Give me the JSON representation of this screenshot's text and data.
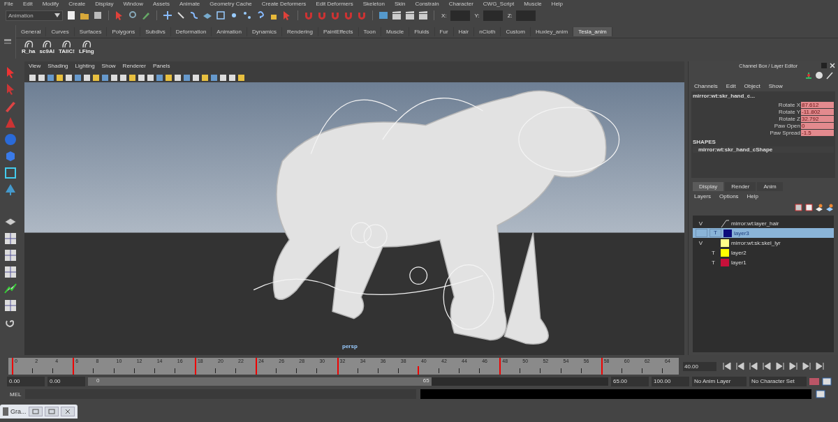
{
  "menu_bar": [
    "File",
    "Edit",
    "Modify",
    "Create",
    "Display",
    "Window",
    "Assets",
    "Animate",
    "Geometry Cache",
    "Create Deformers",
    "Edit Deformers",
    "Skeleton",
    "Skin",
    "Constrain",
    "Character",
    "CWG_Script",
    "Muscle",
    "Help"
  ],
  "status_line": {
    "mode": "Animation",
    "coords": [
      "X:",
      "Y:",
      "Z:"
    ]
  },
  "shelf": {
    "tabs": [
      {
        "label": "General",
        "selected": false
      },
      {
        "label": "Curves",
        "selected": false
      },
      {
        "label": "Surfaces",
        "selected": false
      },
      {
        "label": "Polygons",
        "selected": false
      },
      {
        "label": "Subdivs",
        "selected": false
      },
      {
        "label": "Deformation",
        "selected": false
      },
      {
        "label": "Animation",
        "selected": false
      },
      {
        "label": "Dynamics",
        "selected": false
      },
      {
        "label": "Rendering",
        "selected": false
      },
      {
        "label": "PaintEffects",
        "selected": false
      },
      {
        "label": "Toon",
        "selected": false
      },
      {
        "label": "Muscle",
        "selected": false
      },
      {
        "label": "Fluids",
        "selected": false
      },
      {
        "label": "Fur",
        "selected": false
      },
      {
        "label": "Hair",
        "selected": false
      },
      {
        "label": "nCloth",
        "selected": false
      },
      {
        "label": "Custom",
        "selected": false
      },
      {
        "label": "Huxley_anim",
        "selected": false
      },
      {
        "label": "Tesla_anim",
        "selected": true
      }
    ],
    "items": [
      "R_ha",
      "sc9Al",
      "TAllC!",
      "LFing"
    ]
  },
  "viewport": {
    "menus": [
      "View",
      "Shading",
      "Lighting",
      "Show",
      "Renderer",
      "Panels"
    ],
    "camera": "persp"
  },
  "channel_box": {
    "title": "Channel Box / Layer Editor",
    "menus": [
      "Channels",
      "Edit",
      "Object",
      "Show"
    ],
    "object": "mirror:wt:skr_hand_c...",
    "channels": [
      {
        "name": "Rotate X",
        "value": "87.612",
        "keyed": true
      },
      {
        "name": "Rotate Y",
        "value": "-11.802",
        "keyed": true
      },
      {
        "name": "Rotate Z",
        "value": "32.792",
        "keyed": true
      },
      {
        "name": "Paw Open",
        "value": "0",
        "keyed": true
      },
      {
        "name": "Paw Spread",
        "value": "-1.5",
        "keyed": true
      }
    ],
    "shapes_heading": "SHAPES",
    "shape": "mirror:wt:skr_hand_cShape"
  },
  "layer_editor": {
    "tabs": [
      {
        "label": "Display",
        "selected": true
      },
      {
        "label": "Render",
        "selected": false
      },
      {
        "label": "Anim",
        "selected": false
      }
    ],
    "menus": [
      "Layers",
      "Options",
      "Help"
    ],
    "layers": [
      {
        "visibility": "V",
        "name": "mirror:wt:layer_hair",
        "selected": false
      },
      {
        "display_type": "T",
        "color": "#0b0b7a",
        "name": "layer3",
        "selected": true
      },
      {
        "visibility": "V",
        "color": "#ffff88",
        "name": "mirror:wt:sk:skel_lyr",
        "selected": false
      },
      {
        "display_type": "T",
        "color": "#ffff00",
        "name": "layer2",
        "selected": false
      },
      {
        "display_type": "T",
        "color": "#c8103a",
        "name": "layer1",
        "selected": false
      }
    ]
  },
  "time_slider": {
    "ticks": [
      {
        "label": "0",
        "key": true
      },
      {
        "label": "2",
        "key": false
      },
      {
        "label": "4",
        "key": false
      },
      {
        "label": "6",
        "key": true
      },
      {
        "label": "8",
        "key": false
      },
      {
        "label": "10",
        "key": false
      },
      {
        "label": "12",
        "key": false
      },
      {
        "label": "14",
        "key": false
      },
      {
        "label": "16",
        "key": false
      },
      {
        "label": "18",
        "key": true
      },
      {
        "label": "20",
        "key": false
      },
      {
        "label": "22",
        "key": false
      },
      {
        "label": "24",
        "key": true
      },
      {
        "label": "26",
        "key": false
      },
      {
        "label": "28",
        "key": false
      },
      {
        "label": "30",
        "key": false
      },
      {
        "label": "32",
        "key": true
      },
      {
        "label": "34",
        "key": false
      },
      {
        "label": "36",
        "key": false
      },
      {
        "label": "38",
        "key": false
      },
      {
        "label": "40",
        "key": false
      },
      {
        "label": "42",
        "key": false
      },
      {
        "label": "44",
        "key": false
      },
      {
        "label": "46",
        "key": false
      },
      {
        "label": "48",
        "key": true
      },
      {
        "label": "50",
        "key": false
      },
      {
        "label": "52",
        "key": false
      },
      {
        "label": "54",
        "key": false
      },
      {
        "label": "56",
        "key": false
      },
      {
        "label": "58",
        "key": true
      },
      {
        "label": "60",
        "key": false
      },
      {
        "label": "62",
        "key": false
      },
      {
        "label": "64",
        "key": false
      }
    ],
    "level": 0.61,
    "current_frame": "40.00"
  },
  "range_slider": {
    "level": 0.66,
    "start": "0.00",
    "playback_start": "0.00",
    "range_start": "0",
    "range_end": "65",
    "playback_end": "65.00",
    "end": "100.00",
    "anim_layer": "No Anim Layer",
    "character_set": "No Character Set"
  },
  "command_line": {
    "label": "MEL"
  },
  "taskbar": {
    "window": "Gra..."
  }
}
